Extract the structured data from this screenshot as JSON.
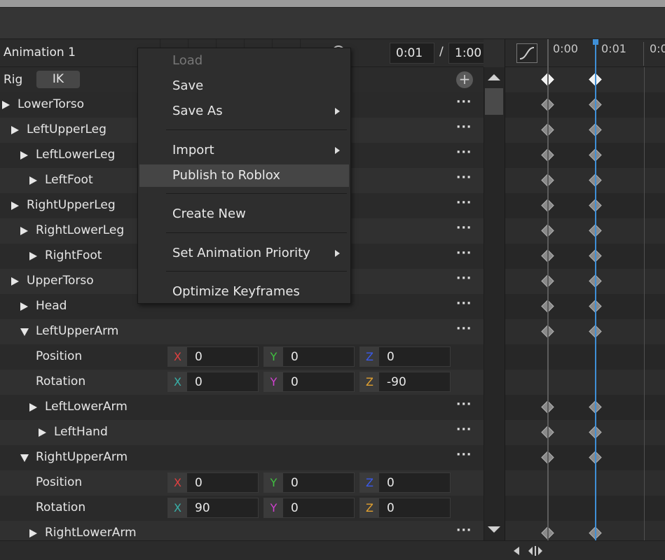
{
  "toolbar": {
    "animation_name": "Animation 1",
    "current_time": "0:01",
    "time_separator": "/",
    "total_time": "1:00"
  },
  "rig": {
    "label": "Rig",
    "ik_label": "IK",
    "add_symbol": "+"
  },
  "tree_rows": [
    {
      "label": "LowerTorso",
      "depth": 0,
      "expanded": false,
      "dots": "···"
    },
    {
      "label": "LeftUpperLeg",
      "depth": 1,
      "expanded": false,
      "dots": "···"
    },
    {
      "label": "LeftLowerLeg",
      "depth": 2,
      "expanded": false,
      "dots": "···"
    },
    {
      "label": "LeftFoot",
      "depth": 3,
      "expanded": false,
      "dots": "···"
    },
    {
      "label": "RightUpperLeg",
      "depth": 1,
      "expanded": false,
      "dots": "···"
    },
    {
      "label": "RightLowerLeg",
      "depth": 2,
      "expanded": false,
      "dots": "···"
    },
    {
      "label": "RightFoot",
      "depth": 3,
      "expanded": false,
      "dots": "···"
    },
    {
      "label": "UpperTorso",
      "depth": 1,
      "expanded": false,
      "dots": "···"
    },
    {
      "label": "Head",
      "depth": 2,
      "expanded": false,
      "dots": "···"
    },
    {
      "label": "LeftUpperArm",
      "depth": 2,
      "expanded": true,
      "dots": "···"
    },
    {
      "label": "Position",
      "prop": true,
      "x": "0",
      "y": "0",
      "z": "0"
    },
    {
      "label": "Rotation",
      "prop": true,
      "x": "0",
      "y": "0",
      "z": "-90"
    },
    {
      "label": "LeftLowerArm",
      "depth": 3,
      "expanded": false,
      "dots": "···"
    },
    {
      "label": "LeftHand",
      "depth": 4,
      "expanded": false,
      "dots": "···"
    },
    {
      "label": "RightUpperArm",
      "depth": 2,
      "expanded": true,
      "dots": "···"
    },
    {
      "label": "Position",
      "prop": true,
      "x": "0",
      "y": "0",
      "z": "0"
    },
    {
      "label": "Rotation",
      "prop": true,
      "x": "90",
      "y": "0",
      "z": "0"
    },
    {
      "label": "RightLowerArm",
      "depth": 3,
      "expanded": false,
      "dots": "···"
    }
  ],
  "axes": {
    "x": "X",
    "y": "Y",
    "z": "Z"
  },
  "axis_colors": {
    "x": "#e04040",
    "y": "#40c040",
    "z": "#3a5ae8",
    "rx": "#38b0a8",
    "ry": "#d040d0",
    "rz": "#e0a030"
  },
  "timeline": {
    "ticks": [
      "0:00",
      "0:01",
      "0:0"
    ],
    "keyframe_rows": [
      1,
      1,
      1,
      1,
      1,
      1,
      1,
      1,
      1,
      1,
      1,
      0,
      0,
      1,
      1,
      1,
      0,
      0,
      1
    ],
    "playhead_color": "#3f8fd6"
  },
  "menu": {
    "items": [
      {
        "label": "Load",
        "disabled": true
      },
      {
        "label": "Save"
      },
      {
        "label": "Save As",
        "submenu": true
      },
      {
        "label": "Import",
        "submenu": true
      },
      {
        "label": "Publish to Roblox",
        "highlighted": true
      },
      {
        "label": "Create New"
      },
      {
        "label": "Set Animation Priority",
        "submenu": true
      },
      {
        "label": "Optimize Keyframes"
      }
    ]
  },
  "icons": {
    "expand": "triangle-right-icon",
    "collapse": "triangle-down-icon",
    "more": "ellipsis-icon",
    "curve": "easing-curve-icon"
  }
}
